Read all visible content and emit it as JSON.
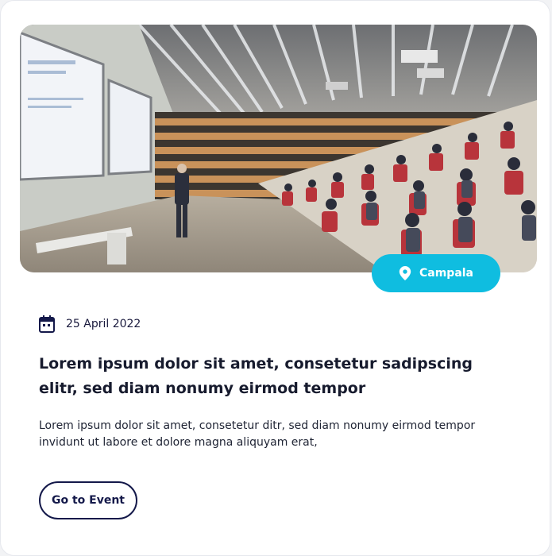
{
  "event": {
    "location": "Campala",
    "date": "25 April 2022",
    "title_line1": "Lorem ipsum dolor sit amet, consetetur sadipscing",
    "title_line2": "elitr, sed diam nonumy eirmod tempor",
    "description_line1": "Lorem ipsum dolor sit amet, consetetur ditr, sed diam nonumy eirmod tempor",
    "description_line2": "invidunt ut labore et dolore magna aliquyam erat,",
    "cta_label": "Go to Event"
  },
  "colors": {
    "accent": "#0fbde0",
    "navy": "#14194a"
  },
  "icons": {
    "location": "map-pin-icon",
    "date": "calendar-icon"
  }
}
